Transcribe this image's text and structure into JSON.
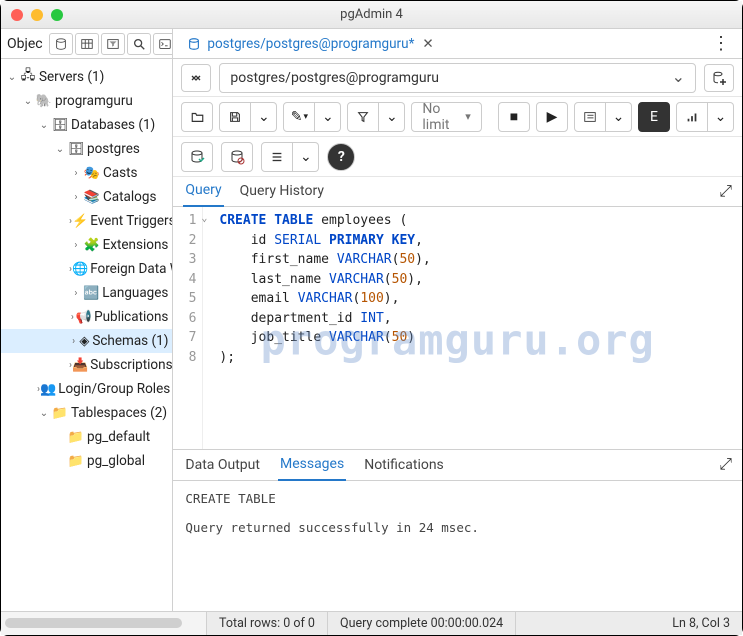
{
  "window": {
    "title": "pgAdmin 4"
  },
  "sidebar": {
    "toolbar_label": "Objec",
    "tree": [
      {
        "level": 0,
        "expand": "down",
        "icon": "server-group",
        "label": "Servers (1)",
        "sel": false
      },
      {
        "level": 1,
        "expand": "down",
        "icon": "server",
        "label": "programguru",
        "sel": false
      },
      {
        "level": 2,
        "expand": "down",
        "icon": "databases",
        "label": "Databases (1)",
        "sel": false
      },
      {
        "level": 3,
        "expand": "down",
        "icon": "database",
        "label": "postgres",
        "sel": false
      },
      {
        "level": 4,
        "expand": "right",
        "icon": "casts",
        "label": "Casts",
        "sel": false
      },
      {
        "level": 4,
        "expand": "right",
        "icon": "catalogs",
        "label": "Catalogs",
        "sel": false
      },
      {
        "level": 4,
        "expand": "right",
        "icon": "event-triggers",
        "label": "Event Triggers",
        "sel": false
      },
      {
        "level": 4,
        "expand": "right",
        "icon": "extensions",
        "label": "Extensions",
        "sel": false
      },
      {
        "level": 4,
        "expand": "right",
        "icon": "fdw",
        "label": "Foreign Data W",
        "sel": false
      },
      {
        "level": 4,
        "expand": "right",
        "icon": "languages",
        "label": "Languages",
        "sel": false
      },
      {
        "level": 4,
        "expand": "right",
        "icon": "publications",
        "label": "Publications",
        "sel": false
      },
      {
        "level": 4,
        "expand": "right",
        "icon": "schemas",
        "label": "Schemas (1)",
        "sel": true
      },
      {
        "level": 4,
        "expand": "right",
        "icon": "subscriptions",
        "label": "Subscriptions",
        "sel": false
      },
      {
        "level": 2,
        "expand": "right",
        "icon": "roles",
        "label": "Login/Group Roles",
        "sel": false
      },
      {
        "level": 2,
        "expand": "down",
        "icon": "tablespaces",
        "label": "Tablespaces (2)",
        "sel": false
      },
      {
        "level": 3,
        "expand": "",
        "icon": "tablespace",
        "label": "pg_default",
        "sel": false
      },
      {
        "level": 3,
        "expand": "",
        "icon": "tablespace",
        "label": "pg_global",
        "sel": false
      }
    ]
  },
  "tab": {
    "label": "postgres/postgres@programguru*",
    "close": "✕"
  },
  "connection": {
    "text": "postgres/postgres@programguru"
  },
  "toolbar": {
    "limit": "No limit",
    "help": "?"
  },
  "query_tabs": {
    "active": "Query",
    "items": [
      "Query",
      "Query History"
    ]
  },
  "editor": {
    "lines": [
      1,
      2,
      3,
      4,
      5,
      6,
      7,
      8
    ]
  },
  "sql": {
    "l1_kw1": "CREATE",
    "l1_kw2": "TABLE",
    "l1_id": "employees",
    "l1_p": " (",
    "l2_id": "id ",
    "l2_ty": "SERIAL",
    "l2_pk": " PRIMARY KEY",
    "l2_c": ",",
    "l3_id": "first_name ",
    "l3_ty": "VARCHAR",
    "l3_p1": "(",
    "l3_n": "50",
    "l3_p2": "),",
    "l4_id": "last_name ",
    "l4_ty": "VARCHAR",
    "l4_p1": "(",
    "l4_n": "50",
    "l4_p2": "),",
    "l5_id": "email ",
    "l5_ty": "VARCHAR",
    "l5_p1": "(",
    "l5_n": "100",
    "l5_p2": "),",
    "l6_id": "department_id ",
    "l6_ty": "INT",
    "l6_c": ",",
    "l7_id": "job_title ",
    "l7_ty": "VARCHAR",
    "l7_p1": "(",
    "l7_n": "50",
    "l7_p2": ")",
    "l8": ");"
  },
  "watermark": "programguru.org",
  "output_tabs": {
    "active": "Messages",
    "items": [
      "Data Output",
      "Messages",
      "Notifications"
    ]
  },
  "output": {
    "line1": "CREATE TABLE",
    "line2": "Query returned successfully in 24 msec."
  },
  "status": {
    "rows": "Total rows: 0 of 0",
    "query": "Query complete 00:00:00.024",
    "pos": "Ln 8, Col 3"
  }
}
